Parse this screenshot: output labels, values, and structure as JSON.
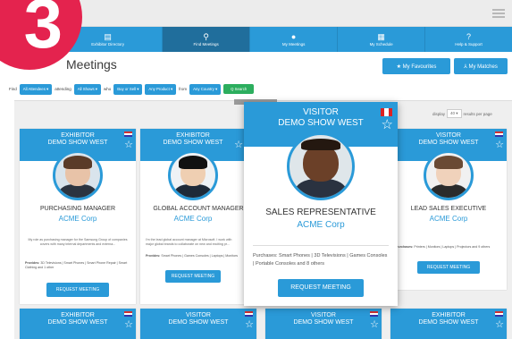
{
  "step_badge": "3",
  "nav": {
    "items": [
      {
        "label": "Exhibitor Directory",
        "icon": "book-icon"
      },
      {
        "label": "Find Meetings",
        "icon": "search-icon"
      },
      {
        "label": "My Meetings",
        "icon": "chat-icon"
      },
      {
        "label": "My Schedule",
        "icon": "calendar-icon"
      },
      {
        "label": "Help & Support",
        "icon": "question-icon"
      }
    ],
    "active": "Find Meetings"
  },
  "page": {
    "title": "Meetings",
    "favourites_label": "★ My Favourites",
    "matches_label": "⅄ My Matches"
  },
  "filter": {
    "find": "Find",
    "attendees": "All Attendees ▾",
    "attending": "attending",
    "shows": "All Shows ▾",
    "who": "who",
    "buy_sell": "Buy or Sell ▾",
    "product": "Any Product ▾",
    "from": "from",
    "country": "Any Country ▾",
    "search": "Q Search"
  },
  "display": {
    "prefix": "display",
    "value": "40 ▾",
    "suffix": "results per page"
  },
  "cards": [
    {
      "type": "EXHIBITOR",
      "show": "DEMO SHOW WEST",
      "role": "PURCHASING MANAGER",
      "company": "ACME Corp",
      "bio": "My role as purchasing manager for the Samsung Group of companies covers with many internal departments and externa...",
      "prov_label": "Provides:",
      "provides": "3D Televisions | Smart Phones | Smart Phone Repair | Smart Clothing and 1 other",
      "button": "REQUEST MEETING"
    },
    {
      "type": "EXHIBITOR",
      "show": "DEMO SHOW WEST",
      "role": "GLOBAL ACCOUNT MANAGER",
      "company": "ACME Corp",
      "bio": "I'm the lead global account manager at Microsoft. I work with major global brands to collaborate on new and exciting pr...",
      "prov_label": "Provides:",
      "provides": "Smart Phones | Games Consoles | Laptops | Monitors",
      "button": "REQUEST MEETING"
    },
    {
      "type": "VISITOR",
      "show": "DEMO SHOW WEST",
      "role": "SALES REPRESENTATIVE",
      "company": "ACME Corp",
      "prov_label": "Purchases:",
      "provides": "Smart Phones | 3D Televisions | Games Consoles | Portable Consoles and 8 others",
      "button": "REQUEST MEETING"
    },
    {
      "type": "VISITOR",
      "show": "DEMO SHOW WEST",
      "role": "LEAD SALES EXECUTIVE",
      "company": "ACME Corp",
      "prov_label": "Purchases:",
      "provides": "Printers | Monitors | Laptops | Projectors and 9 others",
      "button": "REQUEST MEETING"
    }
  ],
  "row2": [
    {
      "type": "EXHIBITOR",
      "show": "DEMO SHOW WEST"
    },
    {
      "type": "VISITOR",
      "show": "DEMO SHOW WEST"
    },
    {
      "type": "VISITOR",
      "show": "DEMO SHOW WEST"
    },
    {
      "type": "EXHIBITOR",
      "show": "DEMO SHOW WEST"
    }
  ],
  "colors": {
    "accent": "#2a9ad8",
    "nav_active": "#206e9c",
    "badge": "#e4234e",
    "search": "#2cae5e"
  }
}
